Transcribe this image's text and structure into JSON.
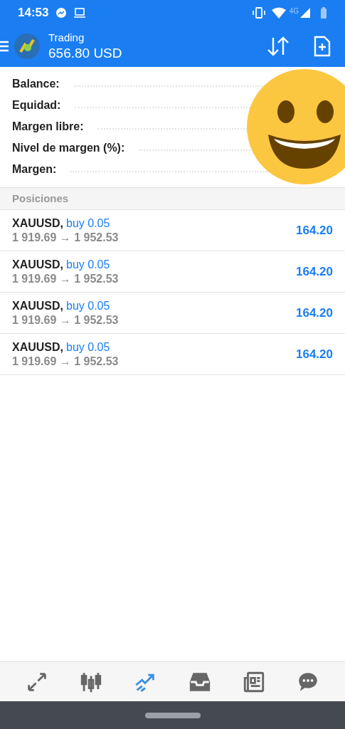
{
  "status_bar": {
    "time": "14:53",
    "network": "4G"
  },
  "header": {
    "title": "Trading",
    "balance": "656.80 USD"
  },
  "summary": [
    {
      "label": "Balance:"
    },
    {
      "label": "Equidad:"
    },
    {
      "label": "Margen libre:"
    },
    {
      "label": "Nivel de margen (%):"
    },
    {
      "label": "Margen:"
    }
  ],
  "section": "Posiciones",
  "positions": [
    {
      "symbol": "XAUUSD,",
      "order": "buy 0.05",
      "prices": "1 919.69 → 1 952.53",
      "profit": "164.20"
    },
    {
      "symbol": "XAUUSD,",
      "order": "buy 0.05",
      "prices": "1 919.69 → 1 952.53",
      "profit": "164.20"
    },
    {
      "symbol": "XAUUSD,",
      "order": "buy 0.05",
      "prices": "1 919.69 → 1 952.53",
      "profit": "164.20"
    },
    {
      "symbol": "XAUUSD,",
      "order": "buy 0.05",
      "prices": "1 919.69 → 1 952.53",
      "profit": "164.20"
    }
  ],
  "bottom_nav": [
    {
      "kind": "quotes",
      "selected": false
    },
    {
      "kind": "chart",
      "selected": false
    },
    {
      "kind": "trade",
      "selected": true
    },
    {
      "kind": "history",
      "selected": false
    },
    {
      "kind": "news",
      "selected": false
    },
    {
      "kind": "chat",
      "selected": false
    }
  ]
}
